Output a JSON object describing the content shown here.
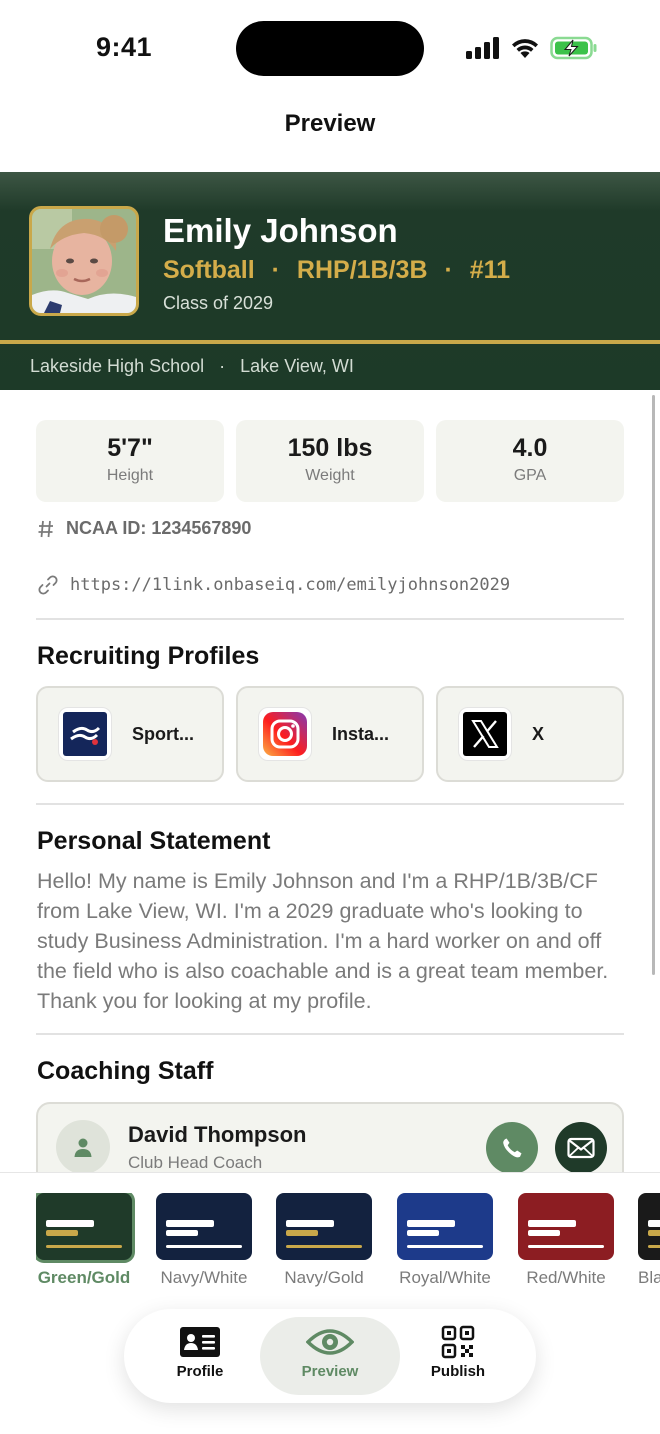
{
  "status_bar": {
    "time": "9:41"
  },
  "nav": {
    "title": "Preview"
  },
  "header": {
    "name": "Emily Johnson",
    "sport": "Softball",
    "positions": "RHP/1B/3B",
    "number": "#11",
    "sep": "·",
    "class_year": "Class of 2029",
    "school": "Lakeside High School",
    "location": "Lake View, WI",
    "colors": {
      "bg": "#1d3a28",
      "accent": "#c9a84a"
    }
  },
  "stats": [
    {
      "value": "5'7\"",
      "label": "Height"
    },
    {
      "value": "150 lbs",
      "label": "Weight"
    },
    {
      "value": "4.0",
      "label": "GPA"
    }
  ],
  "ncaa": {
    "icon": "hash-icon",
    "text": "NCAA ID: 1234567890"
  },
  "link": {
    "icon": "link-icon",
    "url": "https://1link.onbaseiq.com/emilyjohnson2029"
  },
  "recruiting": {
    "title": "Recruiting Profiles",
    "profiles": [
      {
        "name": "Sport...",
        "icon": "sportsrecruits-logo-icon"
      },
      {
        "name": "Insta...",
        "icon": "instagram-logo-icon"
      },
      {
        "name": "X",
        "icon": "x-logo-icon"
      }
    ]
  },
  "statement": {
    "title": "Personal Statement",
    "text": "Hello!  My name is Emily Johnson and I'm a RHP/1B/3B/CF from Lake View, WI.  I'm a 2029 graduate who's looking to study Business Administration.  I'm a hard worker on and off the field who is also coachable and is a great team member.  Thank you for looking at my profile."
  },
  "coaching": {
    "title": "Coaching Staff",
    "coach": {
      "name": "David Thompson",
      "role": "Club Head Coach"
    }
  },
  "themes": [
    {
      "label": "Green/Gold",
      "bg": "#1f3a29",
      "accent": "#c9a84a",
      "selected": true
    },
    {
      "label": "Navy/White",
      "bg": "#13223f",
      "accent": "#ffffff",
      "selected": false
    },
    {
      "label": "Navy/Gold",
      "bg": "#13223f",
      "accent": "#c9a84a",
      "selected": false
    },
    {
      "label": "Royal/White",
      "bg": "#1d3a8a",
      "accent": "#ffffff",
      "selected": false
    },
    {
      "label": "Red/White",
      "bg": "#8c1d22",
      "accent": "#ffffff",
      "selected": false
    },
    {
      "label": "Bla",
      "bg": "#1a1a1a",
      "accent": "#c9a84a",
      "selected": false
    }
  ],
  "tabs": [
    {
      "label": "Profile",
      "icon": "id-card-icon",
      "active": false
    },
    {
      "label": "Preview",
      "icon": "eye-icon",
      "active": true
    },
    {
      "label": "Publish",
      "icon": "qr-code-icon",
      "active": false
    }
  ],
  "accent_green": "#5f8a64"
}
